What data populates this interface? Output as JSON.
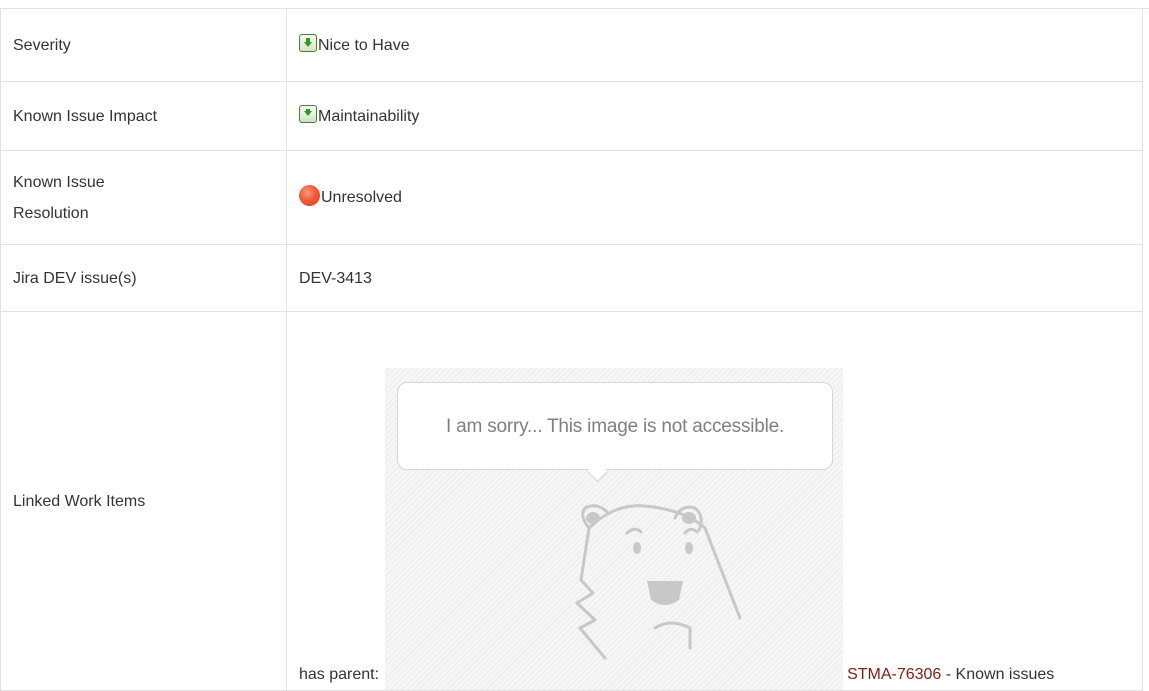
{
  "fields": {
    "severity": {
      "label": "Severity",
      "value": "Nice to Have",
      "icon": "priority-green-down-icon"
    },
    "impact": {
      "label": "Known Issue Impact",
      "value": "Maintainability",
      "icon": "priority-green-down-bar-icon"
    },
    "resolution": {
      "label": "Known Issue Resolution",
      "value": "Unresolved",
      "icon": "red-circle-icon"
    },
    "jira": {
      "label": "Jira DEV issue(s)",
      "value": "DEV-3413"
    },
    "linked": {
      "label": "Linked Work Items",
      "prefix": "has parent:",
      "image_message": "I am sorry... This image is not accessible.",
      "link_text": "STMA-76306",
      "suffix": " - Known issues"
    }
  },
  "colors": {
    "border": "#e2e2e2",
    "text": "#333333",
    "link": "#7a1f10"
  }
}
